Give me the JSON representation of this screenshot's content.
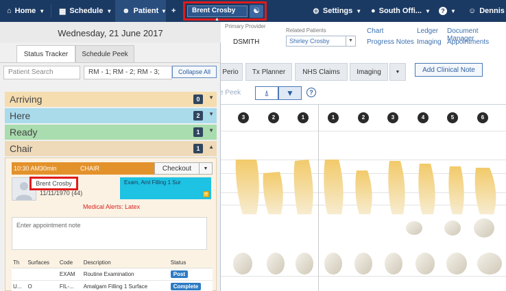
{
  "nav": {
    "home": "Home",
    "schedule": "Schedule",
    "patient": "Patient",
    "add": "+",
    "current_patient": "Brent Crosby",
    "settings": "Settings",
    "office": "South Offi...",
    "help": "?",
    "user": "Dennis"
  },
  "header": {
    "primary_provider_label": "Primary Provider",
    "primary_provider_value": "DSMITH",
    "related_patients_label": "Related Patients",
    "related_patients_value": "Shirley Crosby",
    "links": [
      "Chart",
      "Progress Notes",
      "Ledger",
      "Imaging",
      "Document Manager",
      "Appointments"
    ]
  },
  "main_tabs": [
    "Perio",
    "Tx Planner",
    "NHS Claims",
    "Imaging"
  ],
  "add_clinical_note": "Add Clinical Note",
  "tool_row": {
    "peek_fragment": "e Peek",
    "help": "?"
  },
  "tooth_numbers": [
    "3",
    "2",
    "1",
    "1",
    "2",
    "3",
    "4",
    "5",
    "6"
  ],
  "panel": {
    "date": "Wednesday, 21 June 2017",
    "tabs": [
      "Status Tracker",
      "Schedule Peek"
    ],
    "search_placeholder": "Patient Search",
    "rooms": "RM - 1; RM - 2; RM - 3;",
    "collapse_all": "Collapse All",
    "statuses": [
      {
        "label": "Arriving",
        "count": "0",
        "color": "#f5ddb0"
      },
      {
        "label": "Here",
        "count": "2",
        "color": "#a9dbeb"
      },
      {
        "label": "Ready",
        "count": "1",
        "color": "#a9dcae"
      },
      {
        "label": "Chair",
        "count": "1",
        "color": "#eed9b8"
      }
    ]
  },
  "appointment": {
    "time": "10:30 AM",
    "duration": "30min",
    "status": "CHAIR",
    "checkout": "Checkout",
    "patient_name": "Brent Crosby",
    "dob": "11/11/1970 (44)",
    "procedure_summary": "Exam, Aml Filling 1 Sur",
    "medical_alerts": "Medical Alerts: Latex",
    "note_placeholder": "Enter appointment note",
    "table_headers": [
      "Th",
      "Surfaces",
      "Code",
      "Description",
      "Status"
    ],
    "rows": [
      {
        "th": "",
        "surfaces": "",
        "code": "EXAM",
        "desc": "Routine Examination",
        "status": "Post"
      },
      {
        "th": "U...",
        "surfaces": "O",
        "code": "FIL-...",
        "desc": "Amalgam Filling 1 Surface",
        "status": "Complete"
      }
    ]
  },
  "colors": {
    "nav_bg": "#1b3a63",
    "highlight": "#e01b1b",
    "appt_header": "#e3922b",
    "procedure": "#1ec2e2"
  }
}
